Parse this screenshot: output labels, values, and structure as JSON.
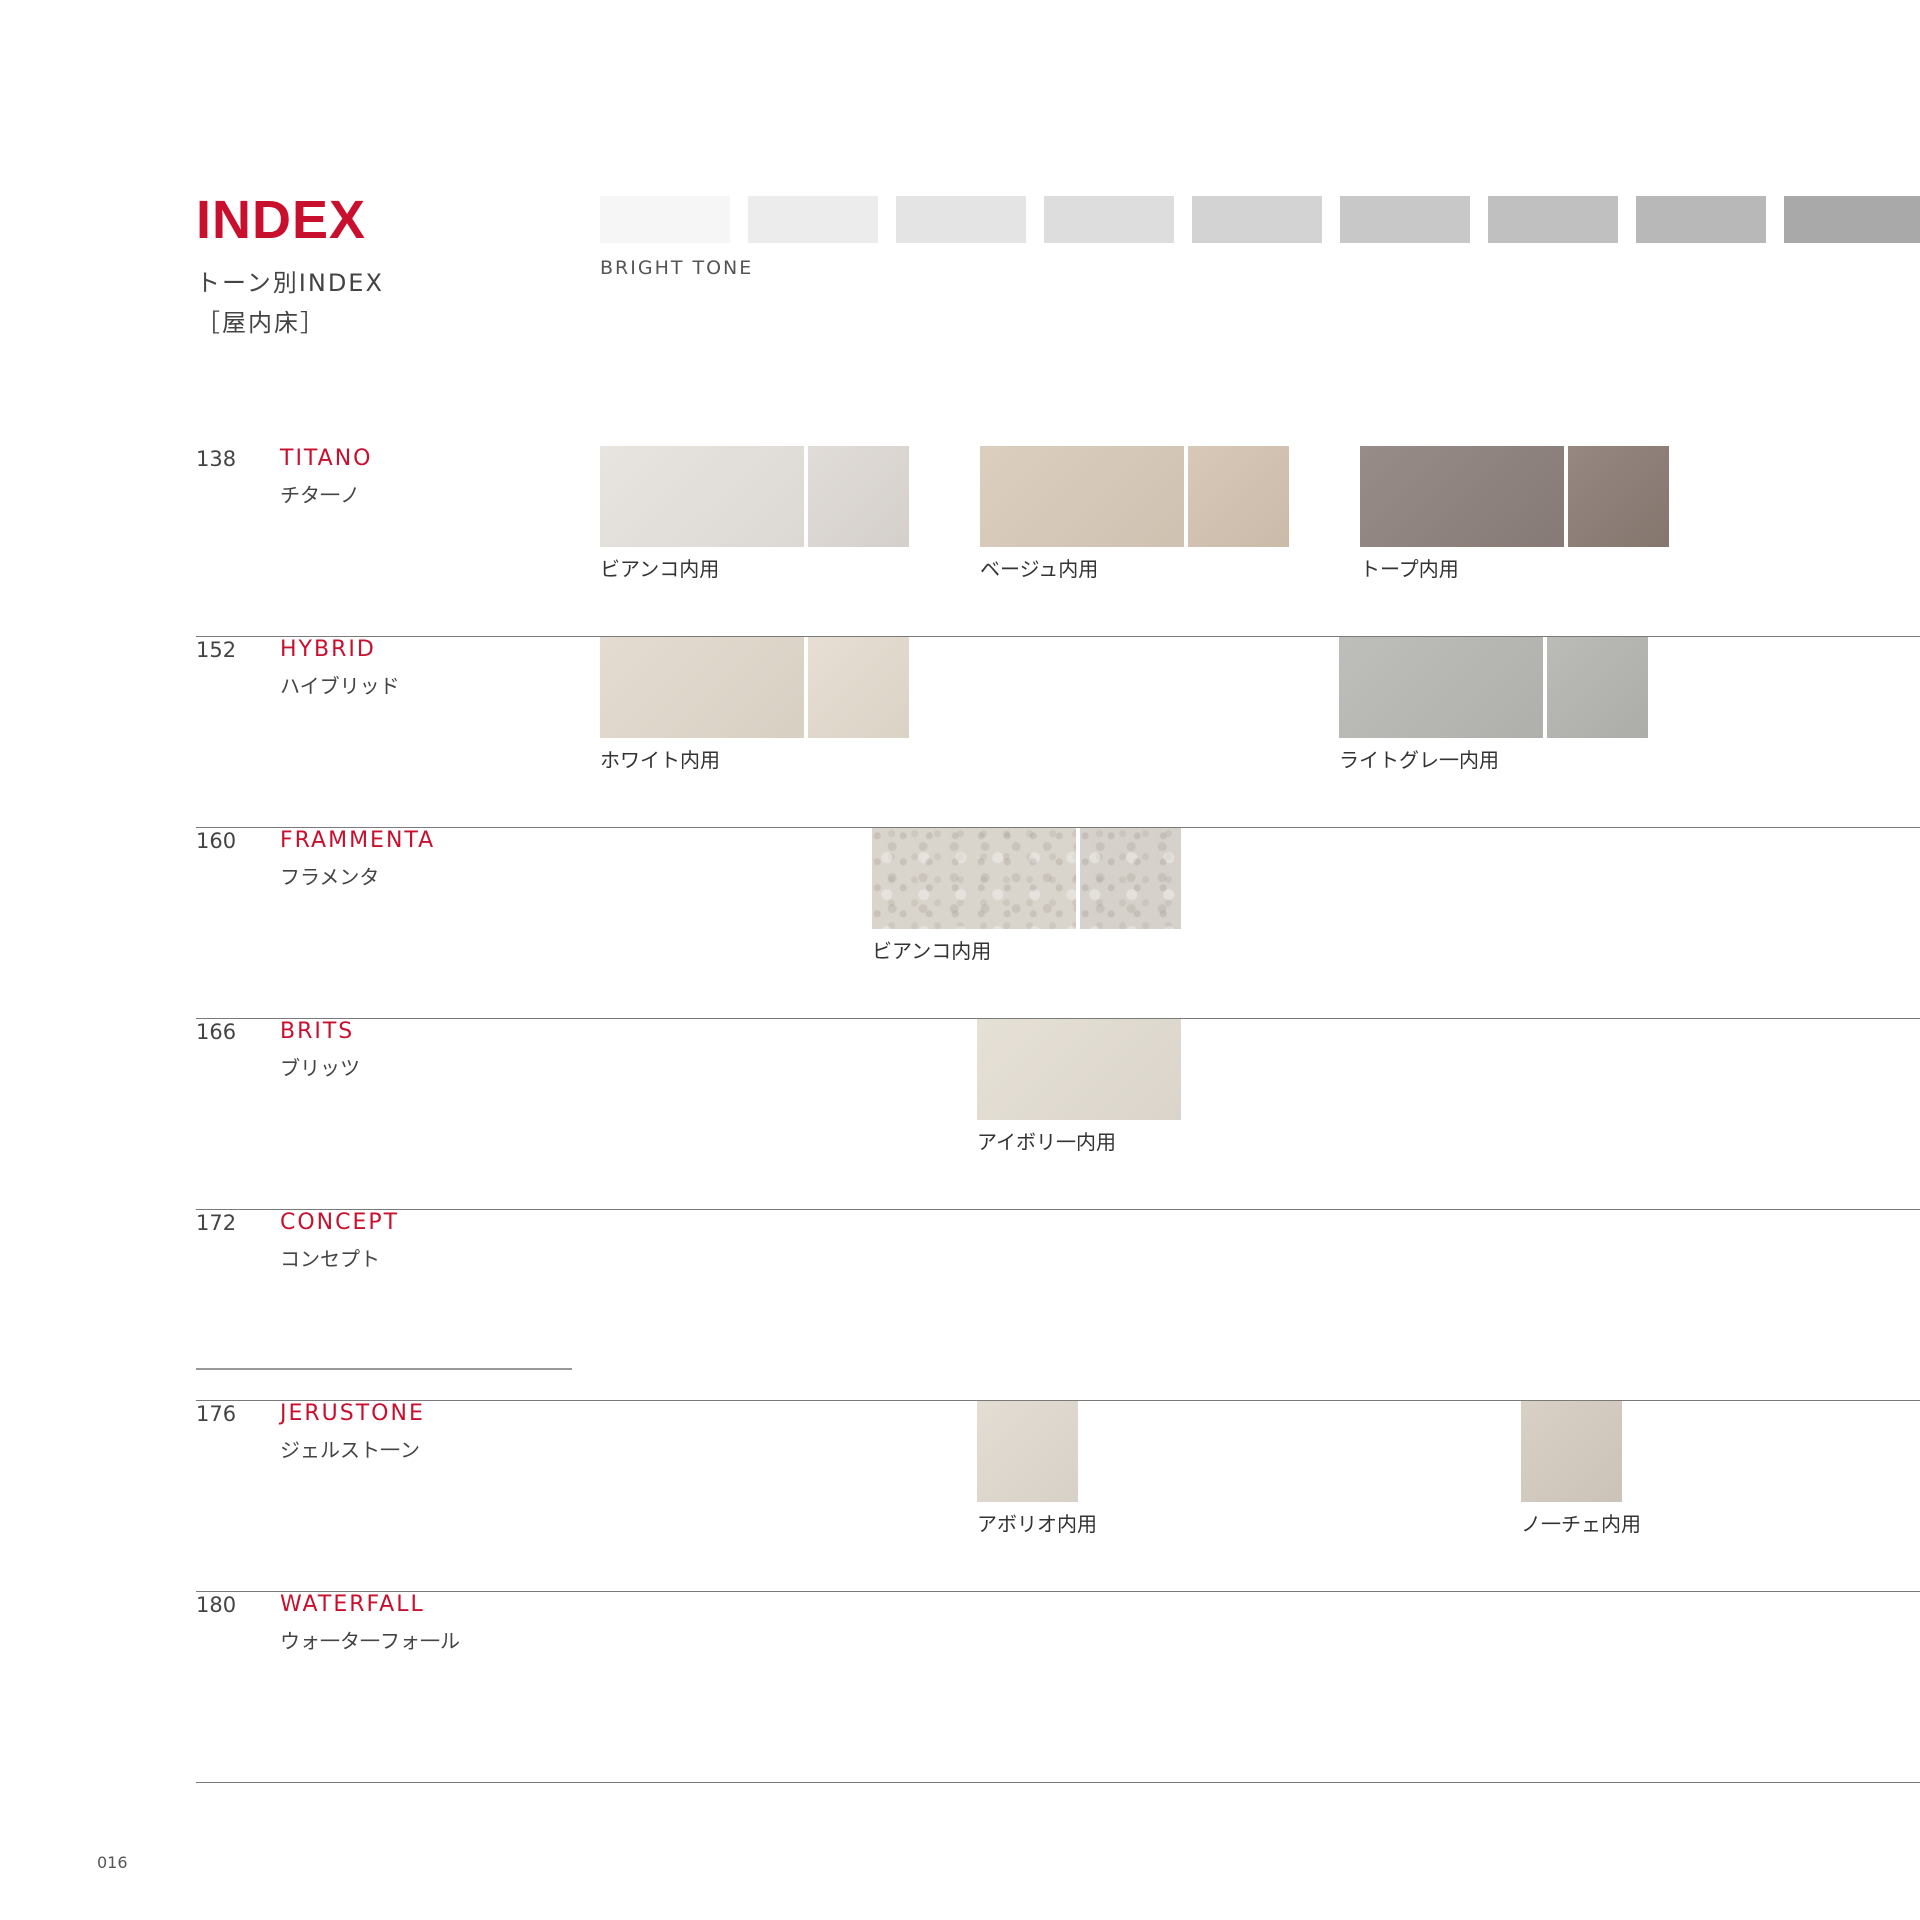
{
  "header": {
    "title": "INDEX",
    "subtitle": "トーン別INDEX",
    "subtitle2": "［屋内床］",
    "tone_label": "BRIGHT TONE",
    "tone_swatches": [
      "#f6f6f6",
      "#ececec",
      "#e4e4e4",
      "#dddddd",
      "#d3d3d3",
      "#c8c8c8",
      "#c0c0c0",
      "#b8b8b8",
      "#a9a9a9"
    ]
  },
  "rows": [
    {
      "page": "138",
      "name": "TITANO",
      "name_ja": "チタ一ノ",
      "samples": [
        {
          "caption": "ビアンコ内用",
          "color": "#e5e1dc",
          "color2": "#ddd8d3"
        },
        {
          "caption": "ベージュ内用",
          "color": "#d8c9b8",
          "color2": "#d3c2b0"
        },
        {
          "caption": "トープ内用",
          "color": "#8b7f7b",
          "color2": "#8a7a72"
        }
      ]
    },
    {
      "page": "152",
      "name": "HYBRID",
      "name_ja": "ハイブリッド",
      "samples": [
        {
          "caption": "ホワイト内用",
          "color": "#e1d8cb",
          "color2": "#e4dbce"
        },
        {
          "caption": "ライトグレ一内用",
          "color": "#b6b7b3",
          "color2": "#b3b4b0"
        }
      ]
    },
    {
      "page": "160",
      "name": "FRAMMENTA",
      "name_ja": "フラメンタ",
      "samples": [
        {
          "caption": "ビアンコ内用",
          "color": "#d9d4cc",
          "color2": "#d6d1ca"
        }
      ]
    },
    {
      "page": "166",
      "name": "BRITS",
      "name_ja": "ブリッツ",
      "samples": [
        {
          "caption": "アイボリ一内用",
          "color": "#e3ddd2"
        }
      ]
    },
    {
      "page": "172",
      "name": "CONCEPT",
      "name_ja": "コンセプト",
      "samples": []
    },
    {
      "page": "176",
      "name": "JERUSTONE",
      "name_ja": "ジェルスト一ン",
      "samples": [
        {
          "caption": "アボリオ内用",
          "color": "#e0d9cf"
        },
        {
          "caption": "ノ一チェ内用",
          "color": "#d4cbbf"
        }
      ]
    },
    {
      "page": "180",
      "name": "WATERFALL",
      "name_ja": "ウォ一タ一フォ一ル",
      "samples": []
    }
  ],
  "footer": {
    "page_number": "016"
  }
}
